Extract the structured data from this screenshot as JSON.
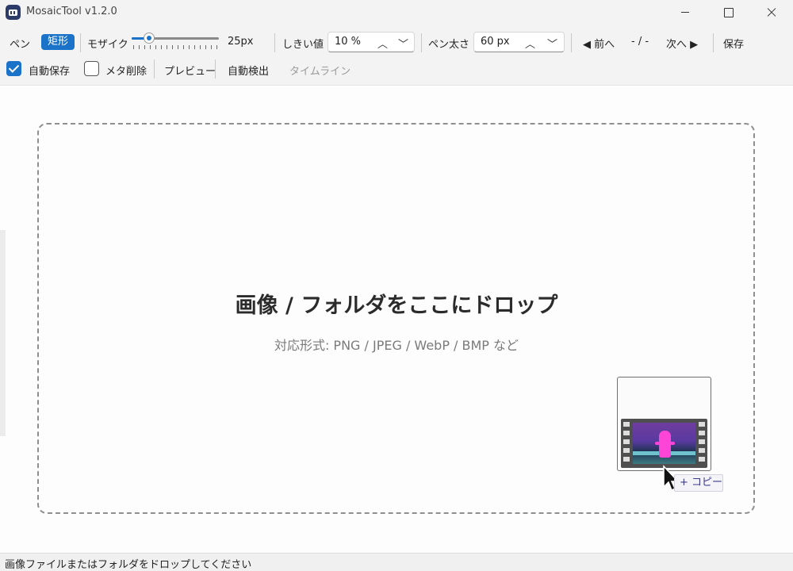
{
  "window": {
    "title": "MosaicTool v1.2.0"
  },
  "toolbar": {
    "pen_label": "ペン",
    "rect_label": "矩形",
    "mosaic_label": "モザイク",
    "mosaic_value": "25px",
    "mosaic_level": 0.2,
    "threshold_label": "しきい値",
    "threshold_value": "10 %",
    "pen_width_label": "ペン太さ",
    "pen_width_value": "60 px",
    "prev_label": "◀ 前へ",
    "page_indicator": "- / -",
    "next_label": "次へ ▶",
    "save_label": "保存"
  },
  "toolbar2": {
    "autosave_label": "自動保存",
    "autosave_checked": true,
    "meta_delete_label": "メタ削除",
    "meta_delete_checked": false,
    "preview_label": "プレビュー",
    "auto_detect_label": "自動検出",
    "timeline_label": "タイムライン"
  },
  "dropzone": {
    "title": "画像 / フォルダをここにドロップ",
    "subtitle": "対応形式: PNG / JPEG / WebP / BMP など"
  },
  "drag": {
    "badge_label": "+ コピー"
  },
  "status": {
    "text": "画像ファイルまたはフォルダをドロップしてください"
  },
  "colors": {
    "accent": "#1a73c8",
    "figure": "#ff44d8"
  }
}
